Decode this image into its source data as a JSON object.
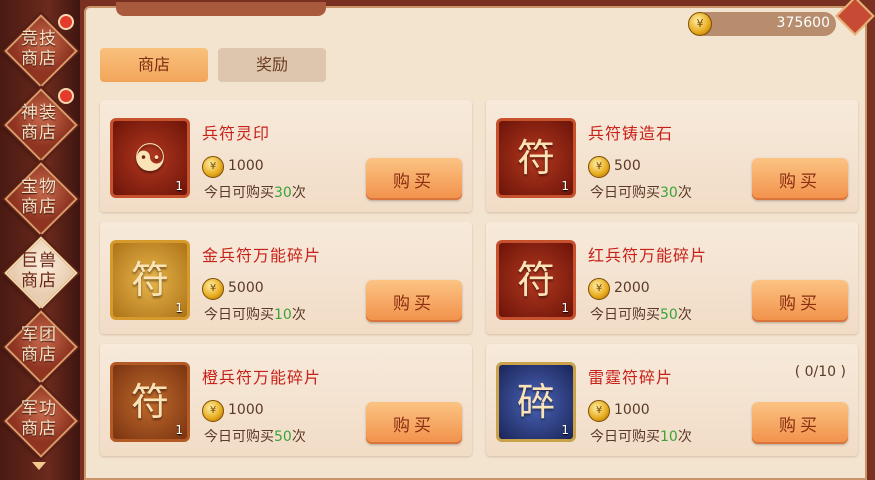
{
  "sidebar": {
    "items": [
      {
        "label": "竞技\n商店",
        "active": false,
        "badge": true
      },
      {
        "label": "神装\n商店",
        "active": false,
        "badge": true
      },
      {
        "label": "宝物\n商店",
        "active": false,
        "badge": false
      },
      {
        "label": "巨兽\n商店",
        "active": true,
        "badge": false
      },
      {
        "label": "军团\n商店",
        "active": false,
        "badge": false
      },
      {
        "label": "军功\n商店",
        "active": false,
        "badge": false
      }
    ]
  },
  "header": {
    "coin_icon": "gold-coin-icon",
    "coin_amount": "375600"
  },
  "tabs": [
    {
      "label": "商店",
      "active": true
    },
    {
      "label": "奖励",
      "active": false
    }
  ],
  "items": [
    {
      "name": "兵符灵印",
      "price": "1000",
      "limit_prefix": "今日可购买",
      "limit_num": "30",
      "limit_suffix": "次",
      "buy_label": "购买",
      "count": "1",
      "icon": "jade-seal-icon",
      "glyph": "☯",
      "frame": "red",
      "progress": ""
    },
    {
      "name": "兵符铸造石",
      "price": "500",
      "limit_prefix": "今日可购买",
      "limit_num": "30",
      "limit_suffix": "次",
      "buy_label": "购买",
      "count": "1",
      "icon": "forging-stone-icon",
      "glyph": "符",
      "frame": "red",
      "progress": ""
    },
    {
      "name": "金兵符万能碎片",
      "price": "5000",
      "limit_prefix": "今日可购买",
      "limit_num": "10",
      "limit_suffix": "次",
      "buy_label": "购买",
      "count": "1",
      "icon": "gold-fragment-icon",
      "glyph": "符",
      "frame": "gold",
      "progress": ""
    },
    {
      "name": "红兵符万能碎片",
      "price": "2000",
      "limit_prefix": "今日可购买",
      "limit_num": "50",
      "limit_suffix": "次",
      "buy_label": "购买",
      "count": "1",
      "icon": "red-fragment-icon",
      "glyph": "符",
      "frame": "red",
      "progress": ""
    },
    {
      "name": "橙兵符万能碎片",
      "price": "1000",
      "limit_prefix": "今日可购买",
      "limit_num": "50",
      "limit_suffix": "次",
      "buy_label": "购买",
      "count": "1",
      "icon": "orange-fragment-icon",
      "glyph": "符",
      "frame": "orange",
      "progress": ""
    },
    {
      "name": "雷霆符碎片",
      "price": "1000",
      "limit_prefix": "今日可购买",
      "limit_num": "10",
      "limit_suffix": "次",
      "buy_label": "购买",
      "count": "1",
      "icon": "thunder-beast-fragment-icon",
      "glyph": "碎",
      "frame": "blue",
      "progress": "( 0/10 )"
    }
  ]
}
